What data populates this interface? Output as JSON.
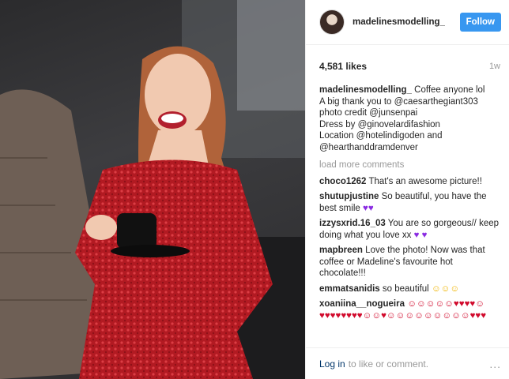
{
  "post": {
    "username": "madelinesmodelling_",
    "follow_label": "Follow",
    "likes": "4,581 likes",
    "time": "1w"
  },
  "caption": {
    "username": "madelinesmodelling_",
    "lines": [
      "Coffee anyone lol",
      "A big thank you to @caesarthegiant303",
      "photo credit @junsenpai",
      "Dress by @ginovelardifashion",
      "Location @hotelindigoden and",
      "@hearthanddramdenver"
    ]
  },
  "load_more": "load more comments",
  "comments": [
    {
      "user": "choco1262",
      "text": "That's an awesome picture!!",
      "emoji": ""
    },
    {
      "user": "shutupjustine",
      "text": "So beautiful, you have the best smile",
      "emoji": "♥♥"
    },
    {
      "user": "izzysxrid.16_03",
      "text": "You are so gorgeous// keep doing what you love xx",
      "emoji": "♥ ♥"
    },
    {
      "user": "mapbreen",
      "text": "Love the photo! Now was that coffee or Madeline's favourite hot chocolate!!!",
      "emoji": ""
    },
    {
      "user": "emmatsanidis",
      "text": "so beautiful",
      "emoji": "☺☺☺"
    },
    {
      "user": "xoaniina__nogueira",
      "text": "",
      "emoji": "☺☺☺☺☺♥♥♥♥☺♥♥♥♥♥♥♥♥☺☺♥☺☺☺☺☺☺☺☺☺♥♥♥"
    }
  ],
  "footer": {
    "login": "Log in",
    "text": "to like or comment.",
    "more": "..."
  }
}
